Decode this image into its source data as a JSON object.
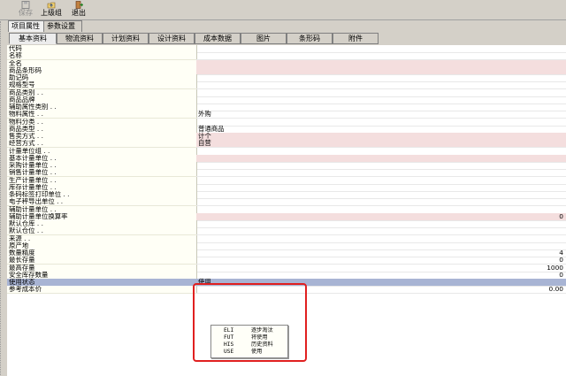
{
  "toolbar": {
    "buttons": [
      {
        "label": "保存",
        "icon": "save-icon"
      },
      {
        "label": "上级组",
        "icon": "folder-up-icon"
      },
      {
        "label": "退出",
        "icon": "exit-icon"
      }
    ]
  },
  "outer_tabs": [
    {
      "label": "项目属性",
      "active": true
    },
    {
      "label": "参数设置",
      "active": false
    }
  ],
  "inner_tabs": [
    {
      "label": "基本资料",
      "active": true
    },
    {
      "label": "物流资料",
      "active": false
    },
    {
      "label": "计划资料",
      "active": false
    },
    {
      "label": "设计资料",
      "active": false
    },
    {
      "label": "成本数据",
      "active": false
    },
    {
      "label": "图片",
      "active": false
    },
    {
      "label": "条形码",
      "active": false
    },
    {
      "label": "附件",
      "active": false
    }
  ],
  "properties": [
    {
      "label": "代码",
      "value": "",
      "num": "",
      "style": ""
    },
    {
      "label": "名称",
      "value": "",
      "num": "",
      "style": ""
    },
    {
      "label": "全名",
      "value": "",
      "num": "",
      "style": "pink"
    },
    {
      "label": "商品条形码",
      "value": "",
      "num": "",
      "style": "pink"
    },
    {
      "label": "助记码",
      "value": "",
      "num": "",
      "style": ""
    },
    {
      "label": "规格型号",
      "value": "",
      "num": "",
      "style": ""
    },
    {
      "label": "商品类别 . .",
      "value": "",
      "num": "",
      "style": ""
    },
    {
      "label": "商品品牌",
      "value": "",
      "num": "",
      "style": ""
    },
    {
      "label": "辅助属性类别 . .",
      "value": "",
      "num": "",
      "style": ""
    },
    {
      "label": "物料属性 . .",
      "value": "外购",
      "num": "",
      "style": ""
    },
    {
      "label": "物料分类 . .",
      "value": "",
      "num": "",
      "style": ""
    },
    {
      "label": "商品类型 . .",
      "value": "普通商品",
      "num": "",
      "style": ""
    },
    {
      "label": "售卖方式 . .",
      "value": "计个",
      "num": "",
      "style": "pink"
    },
    {
      "label": "经营方式 . .",
      "value": "自营",
      "num": "",
      "style": "pink"
    },
    {
      "label": "计量单位组 . .",
      "value": "",
      "num": "",
      "style": ""
    },
    {
      "label": "基本计量单位 . .",
      "value": "",
      "num": "",
      "style": "pink"
    },
    {
      "label": "采购计量单位 . .",
      "value": "",
      "num": "",
      "style": ""
    },
    {
      "label": "销售计量单位 . .",
      "value": "",
      "num": "",
      "style": ""
    },
    {
      "label": "生产计量单位 . .",
      "value": "",
      "num": "",
      "style": ""
    },
    {
      "label": "库存计量单位 . .",
      "value": "",
      "num": "",
      "style": ""
    },
    {
      "label": "条码标签打印单位 . .",
      "value": "",
      "num": "",
      "style": ""
    },
    {
      "label": "电子秤导出单位 . .",
      "value": "",
      "num": "",
      "style": ""
    },
    {
      "label": "辅助计量单位 . .",
      "value": "",
      "num": "",
      "style": ""
    },
    {
      "label": "辅助计量单位换算率",
      "value": "",
      "num": "0",
      "style": "pink"
    },
    {
      "label": "默认仓库 . .",
      "value": "",
      "num": "",
      "style": ""
    },
    {
      "label": "默认仓位 . .",
      "value": "",
      "num": "",
      "style": ""
    },
    {
      "label": "来源 . .",
      "value": "",
      "num": "",
      "style": ""
    },
    {
      "label": "原产地",
      "value": "",
      "num": "",
      "style": ""
    },
    {
      "label": "数量精度",
      "value": "",
      "num": "4",
      "style": ""
    },
    {
      "label": "最长存量",
      "value": "",
      "num": "0",
      "style": ""
    },
    {
      "label": "最高存量",
      "value": "",
      "num": "1000",
      "style": ""
    },
    {
      "label": "安全库存数量",
      "value": "",
      "num": "0",
      "style": ""
    },
    {
      "label": "使用状态",
      "value": "使用",
      "num": "",
      "style": "hl"
    },
    {
      "label": "参考成本价",
      "value": "",
      "num": "0.00",
      "style": ""
    }
  ],
  "status_dropdown": {
    "options": [
      {
        "code": "ELI",
        "text": "逐步淘汰"
      },
      {
        "code": "FUT",
        "text": "将使用"
      },
      {
        "code": "HIS",
        "text": "历史资料"
      },
      {
        "code": "USE",
        "text": "使用"
      }
    ]
  }
}
